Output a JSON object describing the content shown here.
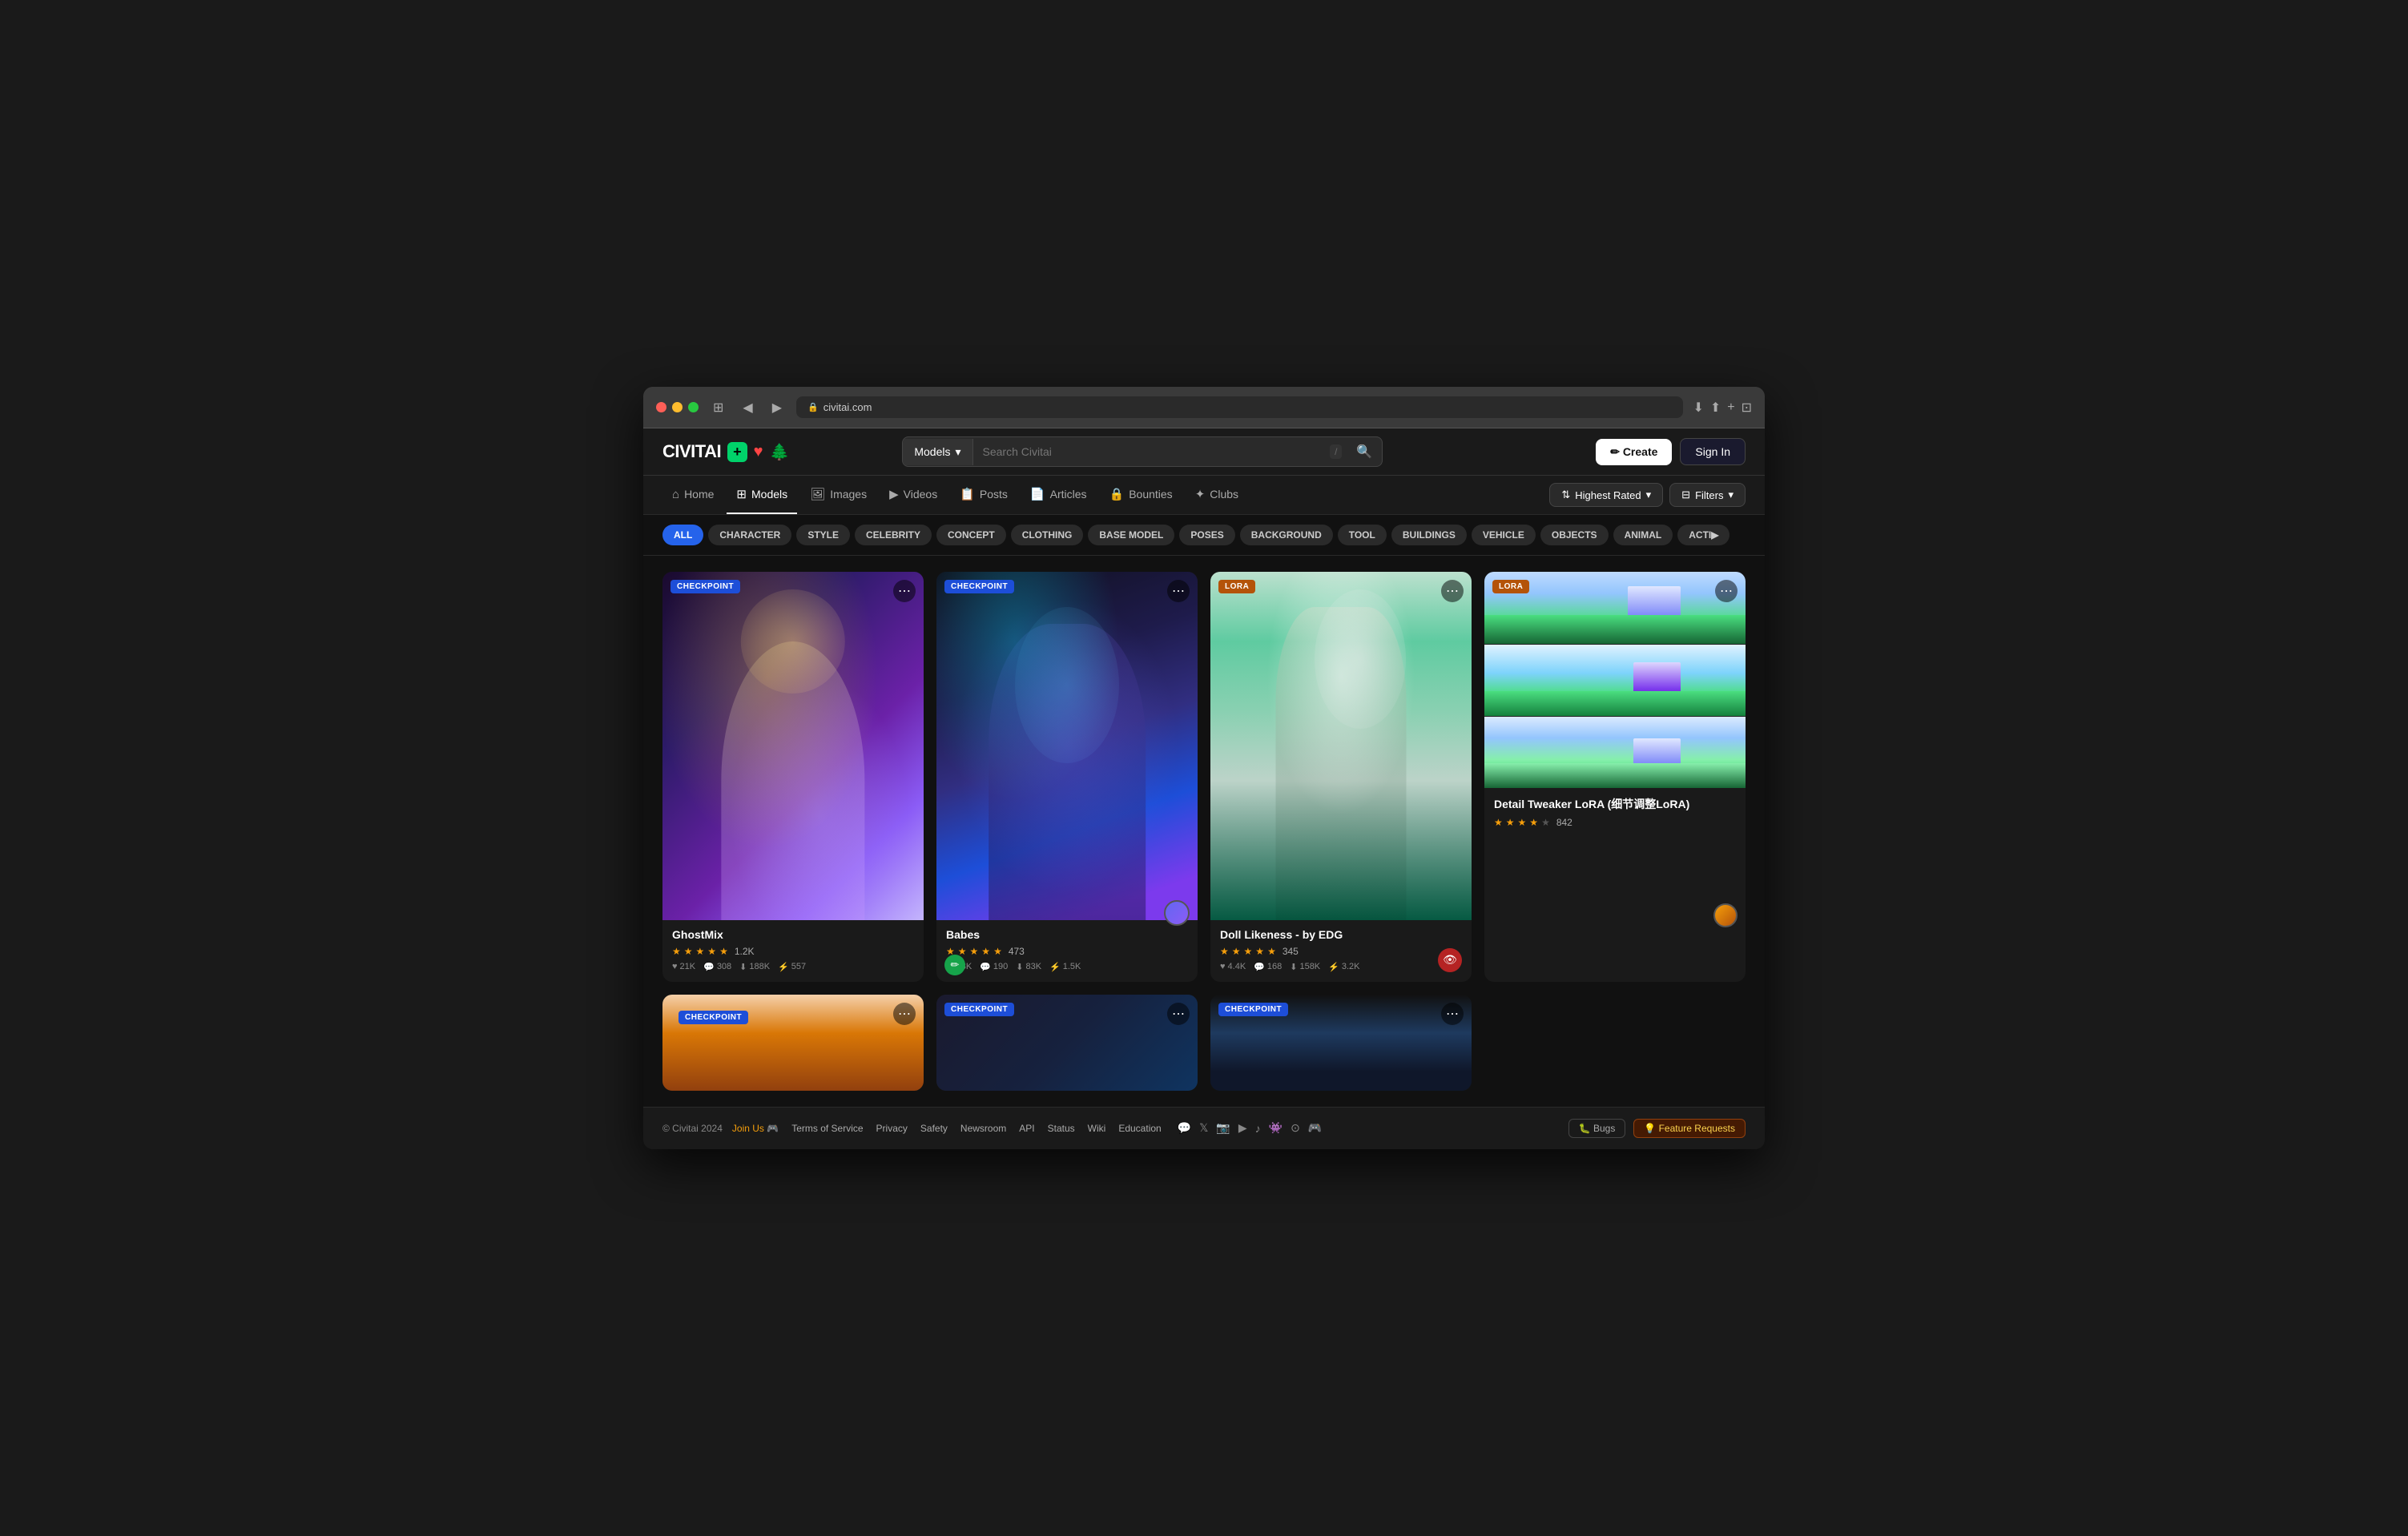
{
  "browser": {
    "url": "civitai.com",
    "back_btn": "◀",
    "forward_btn": "▶"
  },
  "header": {
    "logo": "CIVITAI",
    "logo_plus": "+",
    "search_type": "Models",
    "search_placeholder": "Search Civitai",
    "create_label": "✏ Create",
    "sign_in_label": "Sign In"
  },
  "nav": {
    "items": [
      {
        "id": "home",
        "icon": "⌂",
        "label": "Home"
      },
      {
        "id": "models",
        "icon": "⊞",
        "label": "Models",
        "active": true
      },
      {
        "id": "images",
        "icon": "🖼",
        "label": "Images"
      },
      {
        "id": "videos",
        "icon": "▶",
        "label": "Videos"
      },
      {
        "id": "posts",
        "icon": "📋",
        "label": "Posts"
      },
      {
        "id": "articles",
        "icon": "📄",
        "label": "Articles"
      },
      {
        "id": "bounties",
        "icon": "🔒",
        "label": "Bounties"
      },
      {
        "id": "clubs",
        "icon": "✦",
        "label": "Clubs"
      }
    ],
    "sort_label": "Highest Rated",
    "filters_label": "Filters"
  },
  "categories": {
    "items": [
      {
        "id": "all",
        "label": "ALL",
        "active": true
      },
      {
        "id": "character",
        "label": "CHARACTER",
        "active": false
      },
      {
        "id": "style",
        "label": "STYLE",
        "active": false
      },
      {
        "id": "celebrity",
        "label": "CELEBRITY",
        "active": false
      },
      {
        "id": "concept",
        "label": "CONCEPT",
        "active": false
      },
      {
        "id": "clothing",
        "label": "CLOTHING",
        "active": false
      },
      {
        "id": "base_model",
        "label": "BASE MODEL",
        "active": false
      },
      {
        "id": "poses",
        "label": "POSES",
        "active": false
      },
      {
        "id": "background",
        "label": "BACKGROUND",
        "active": false
      },
      {
        "id": "tool",
        "label": "TOOL",
        "active": false
      },
      {
        "id": "buildings",
        "label": "BUILDINGS",
        "active": false
      },
      {
        "id": "vehicle",
        "label": "VEHICLE",
        "active": false
      },
      {
        "id": "objects",
        "label": "OBJECTS",
        "active": false
      },
      {
        "id": "animal",
        "label": "ANIMAL",
        "active": false
      },
      {
        "id": "action",
        "label": "ACTI▶",
        "active": false
      }
    ]
  },
  "models": [
    {
      "id": "ghostmix",
      "badge": "CHECKPOINT",
      "badge_type": "checkpoint",
      "title": "GhostMix",
      "stars": 5,
      "rating": "1.2K",
      "likes": "21K",
      "comments": "308",
      "downloads": "188K",
      "generations": "557"
    },
    {
      "id": "babes",
      "badge": "CHECKPOINT",
      "badge_type": "checkpoint",
      "title": "Babes",
      "stars": 5,
      "rating": "473",
      "likes": "8.8K",
      "comments": "190",
      "downloads": "83K",
      "generations": "1.5K"
    },
    {
      "id": "doll-likeness",
      "badge": "LORA",
      "badge_type": "lora",
      "title": "Doll Likeness - by EDG",
      "stars": 5,
      "rating": "345",
      "likes": "4.4K",
      "comments": "168",
      "downloads": "158K",
      "generations": "3.2K"
    },
    {
      "id": "detail-tweaker",
      "badge": "LORA",
      "badge_type": "lora",
      "title": "Detail Tweaker LoRA (细节调整LoRA)",
      "stars": 4,
      "rating": "842",
      "likes": "",
      "comments": "",
      "downloads": "",
      "generations": ""
    }
  ],
  "footer": {
    "copyright": "© Civitai 2024",
    "join_us": "Join Us 🎮",
    "links": [
      "Terms of Service",
      "Privacy",
      "Safety",
      "Newsroom",
      "API",
      "Status",
      "Wiki",
      "Education"
    ],
    "bugs_label": "🐛 Bugs",
    "feature_requests_label": "💡 Feature Requests"
  }
}
